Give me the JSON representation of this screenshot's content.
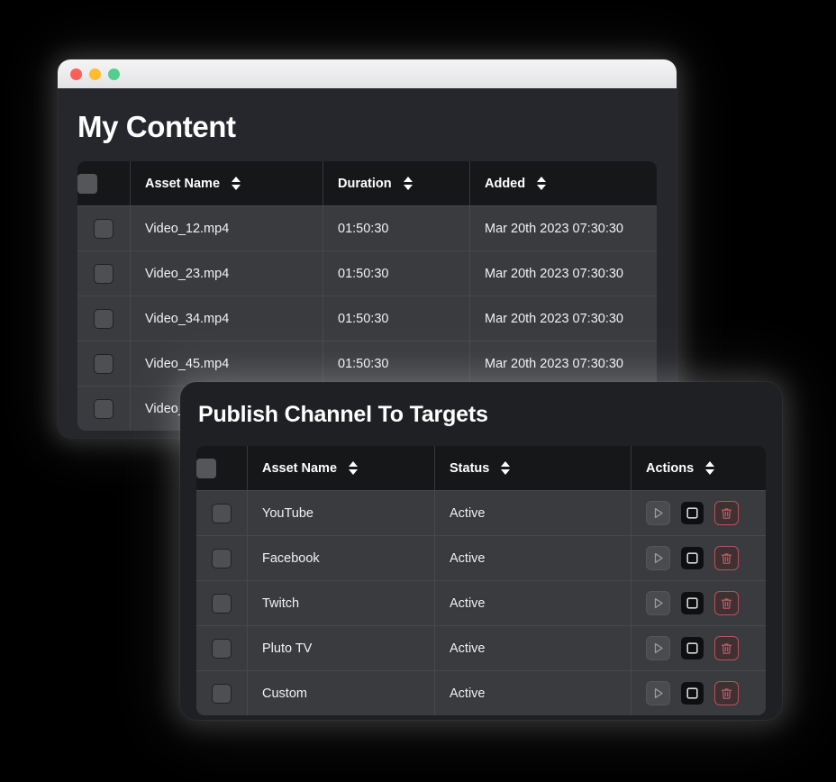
{
  "window": {
    "traffic_lights": [
      {
        "name": "close",
        "color": "#fc5f57"
      },
      {
        "name": "minimize",
        "color": "#febc2e"
      },
      {
        "name": "maximize",
        "color": "#51d08d"
      }
    ],
    "title": "My Content"
  },
  "content_table": {
    "columns": [
      {
        "id": "select",
        "label": ""
      },
      {
        "id": "asset",
        "label": "Asset Name",
        "sortable": true
      },
      {
        "id": "duration",
        "label": "Duration",
        "sortable": true
      },
      {
        "id": "added",
        "label": "Added",
        "sortable": true
      }
    ],
    "rows": [
      {
        "asset": "Video_12.mp4",
        "duration": "01:50:30",
        "added": "Mar 20th 2023 07:30:30"
      },
      {
        "asset": "Video_23.mp4",
        "duration": "01:50:30",
        "added": "Mar 20th 2023 07:30:30"
      },
      {
        "asset": "Video_34.mp4",
        "duration": "01:50:30",
        "added": "Mar 20th 2023 07:30:30"
      },
      {
        "asset": "Video_45.mp4",
        "duration": "01:50:30",
        "added": "Mar 20th 2023 07:30:30"
      },
      {
        "asset": "Video_",
        "duration": "",
        "added": ""
      }
    ]
  },
  "dialog": {
    "title": "Publish Channel To Targets",
    "columns": [
      {
        "id": "select",
        "label": ""
      },
      {
        "id": "asset",
        "label": "Asset Name",
        "sortable": true
      },
      {
        "id": "status",
        "label": "Status",
        "sortable": true
      },
      {
        "id": "actions",
        "label": "Actions",
        "sortable": true
      }
    ],
    "rows": [
      {
        "asset": "YouTube",
        "status": "Active"
      },
      {
        "asset": "Facebook",
        "status": "Active"
      },
      {
        "asset": "Twitch",
        "status": "Active"
      },
      {
        "asset": "Pluto TV",
        "status": "Active"
      },
      {
        "asset": "Custom",
        "status": "Active"
      }
    ],
    "actions": [
      {
        "name": "play-button",
        "title": "Play"
      },
      {
        "name": "stop-button",
        "title": "Stop"
      },
      {
        "name": "delete-button",
        "title": "Delete"
      }
    ]
  },
  "colors": {
    "background": "#000000",
    "card": "#26272c",
    "dialog_card": "#1f2024",
    "table_header": "#161719",
    "table_row": "#3a3b3f",
    "status_green_light": "#0bb07b",
    "status_green_dark": "#137a56",
    "delete_red": "#b8525e"
  }
}
